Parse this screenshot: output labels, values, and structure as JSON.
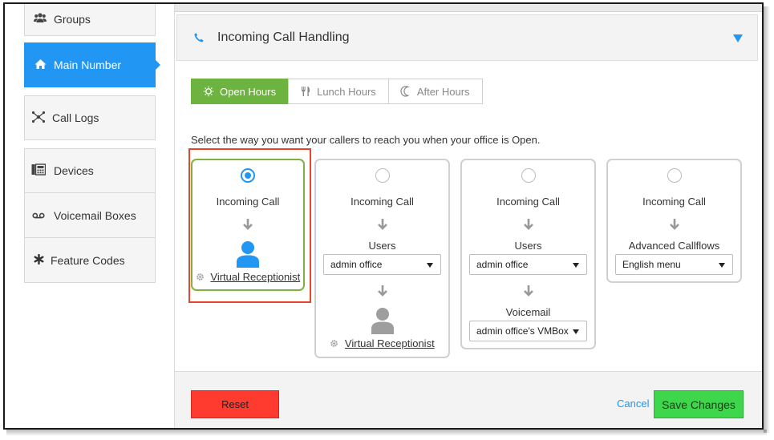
{
  "sidebar": {
    "items": [
      {
        "label": "Groups",
        "icon": "users-icon",
        "active": false
      },
      {
        "label": "Main Number",
        "icon": "home-icon",
        "active": true
      },
      {
        "label": "Call Logs",
        "icon": "call-logs-icon",
        "active": false
      },
      {
        "label": "Devices",
        "icon": "devices-icon",
        "active": false
      },
      {
        "label": "Voicemail Boxes",
        "icon": "voicemail-icon",
        "active": false
      },
      {
        "label": "Feature Codes",
        "icon": "asterisk-icon",
        "active": false
      }
    ]
  },
  "panel": {
    "title": "Incoming Call Handling",
    "tabs": [
      {
        "label": "Open Hours",
        "icon": "sun-icon",
        "active": true
      },
      {
        "label": "Lunch Hours",
        "icon": "utensils-icon",
        "active": false
      },
      {
        "label": "After Hours",
        "icon": "moon-icon",
        "active": false
      }
    ],
    "instruction": "Select the way you want your callers to reach you when your office is Open."
  },
  "options": [
    {
      "selected": true,
      "call_label": "Incoming Call",
      "receptionist_label": "Virtual Receptionist"
    },
    {
      "selected": false,
      "call_label": "Incoming Call",
      "users_label": "Users",
      "users_value": "admin office",
      "receptionist_label": "Virtual Receptionist"
    },
    {
      "selected": false,
      "call_label": "Incoming Call",
      "users_label": "Users",
      "users_value": "admin office",
      "voicemail_label": "Voicemail",
      "voicemail_value": "admin office's VMBox"
    },
    {
      "selected": false,
      "call_label": "Incoming Call",
      "callflows_label": "Advanced Callflows",
      "callflows_value": "English menu"
    }
  ],
  "footer": {
    "reset_label": "Reset",
    "cancel_label": "Cancel",
    "save_label": "Save Changes"
  },
  "colors": {
    "accent": "#2196f3",
    "tab_active": "#6cb33f",
    "reset": "#ff3b30",
    "save": "#3ed64a",
    "highlight": "#e8452c"
  }
}
